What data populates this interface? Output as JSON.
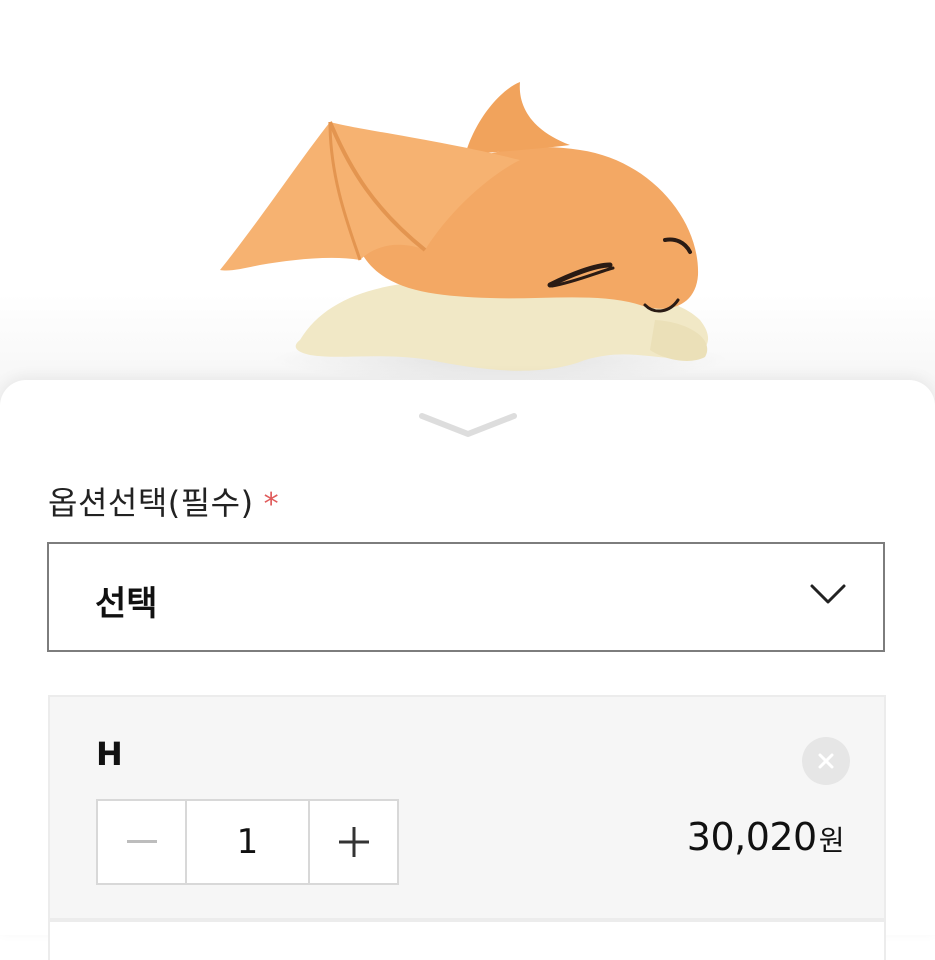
{
  "product": {
    "image_subject": "sleeping orange winged creature figure"
  },
  "option_panel": {
    "label": "옵션선택(필수)",
    "required_mark": "*",
    "select": {
      "value": "선택",
      "icon": "chevron-down-icon"
    },
    "selected_item": {
      "name": "H",
      "quantity": "1",
      "price": "30,020",
      "currency": "원",
      "decrement_icon": "minus-icon",
      "increment_icon": "plus-icon",
      "remove_icon": "close-icon"
    }
  },
  "colors": {
    "required": "#e05b5b",
    "border": "#7d7d7d",
    "card_bg": "#f6f6f6"
  }
}
